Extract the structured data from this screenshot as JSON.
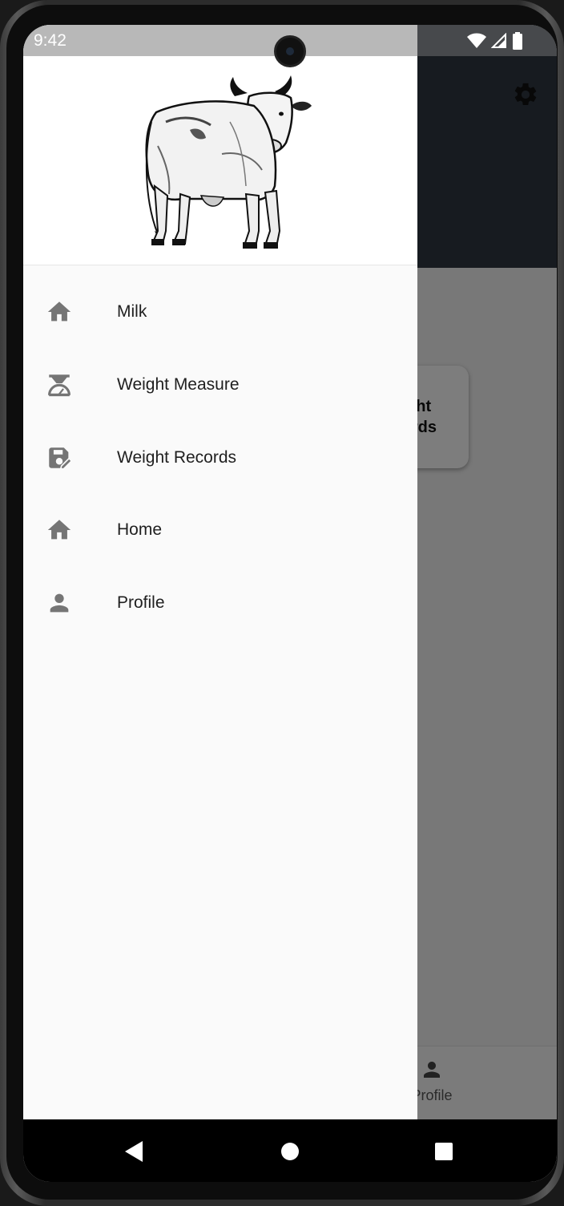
{
  "status_bar": {
    "time": "9:42",
    "icons": [
      "wifi-icon",
      "cell-signal-icon",
      "battery-icon"
    ]
  },
  "app_bar": {
    "settings_icon": "gear-icon",
    "background_color": "#2f3740"
  },
  "background_card": {
    "label": "Weight\nRecords"
  },
  "bottom_nav": {
    "visible_item": {
      "label": "Profile",
      "icon": "person-icon"
    }
  },
  "drawer": {
    "header_image": "cow-illustration",
    "items": [
      {
        "label": "Milk",
        "icon": "home-icon"
      },
      {
        "label": "Weight Measure",
        "icon": "scale-icon"
      },
      {
        "label": "Weight Records",
        "icon": "save-edit-icon"
      },
      {
        "label": "Home",
        "icon": "home-icon"
      },
      {
        "label": "Profile",
        "icon": "person-icon"
      }
    ],
    "icon_color": "#757575"
  },
  "system_nav": {
    "buttons": [
      "back-button",
      "home-button",
      "recents-button"
    ]
  }
}
